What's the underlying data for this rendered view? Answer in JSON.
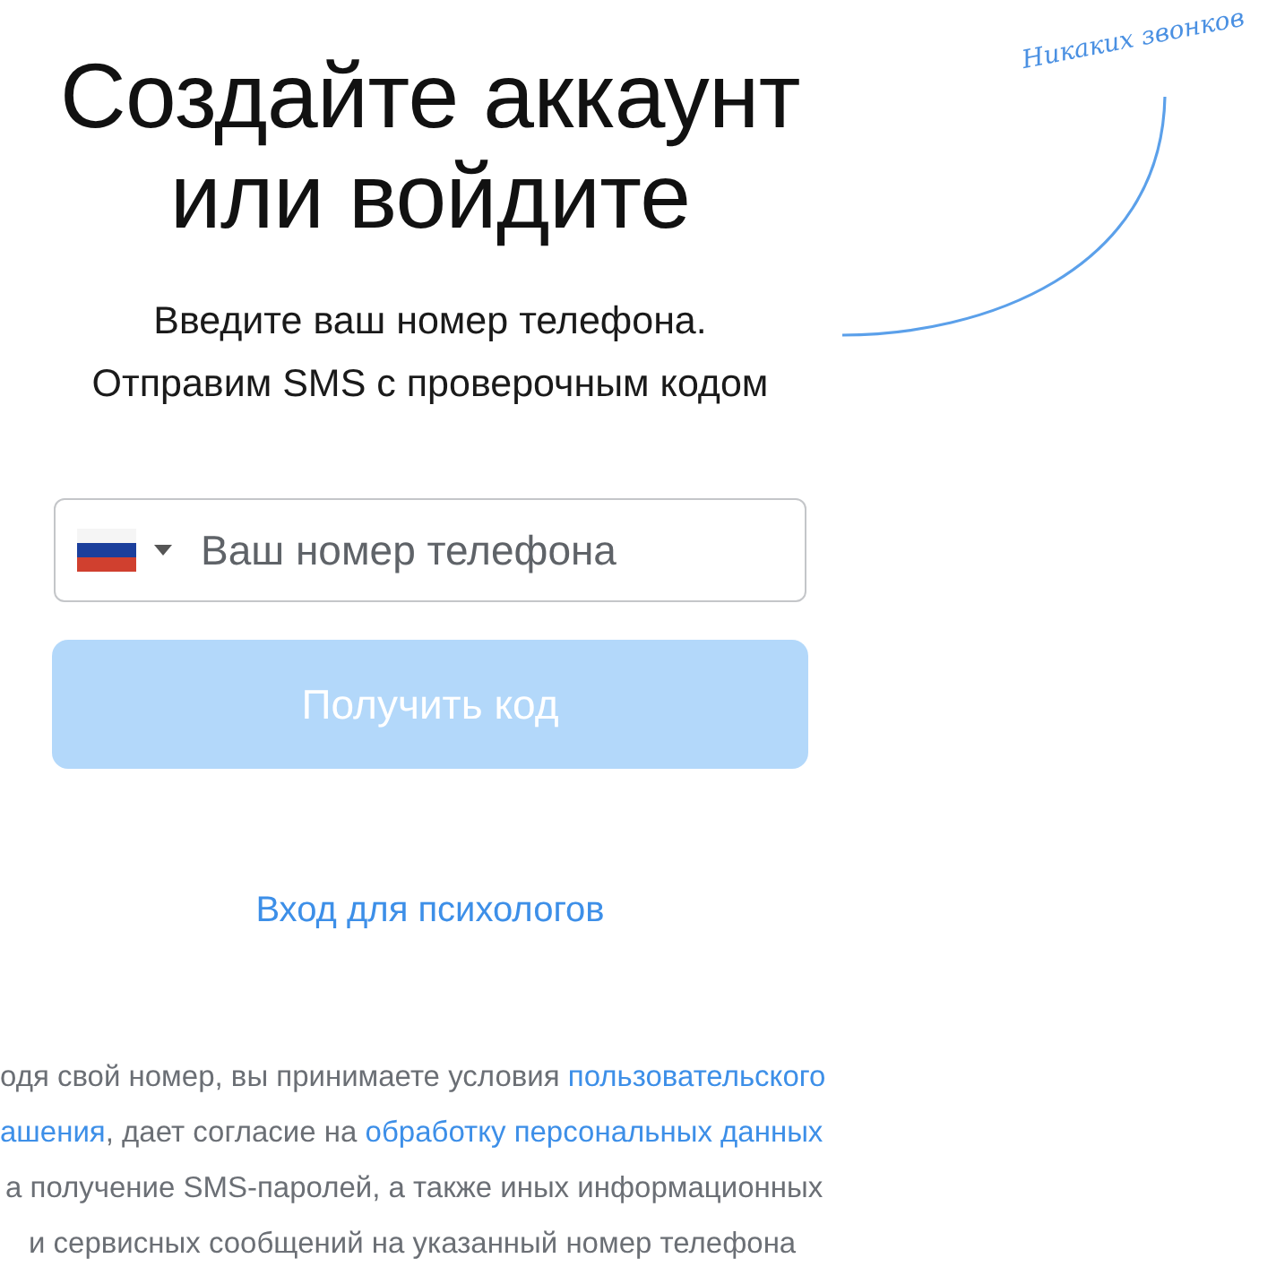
{
  "heading": "Создайте аккаунт или войдите",
  "subtitle": [
    "Введите ваш номер телефона.",
    "Отправим SMS с проверочным кодом"
  ],
  "note": "Никаких звонков",
  "phone_field": {
    "placeholder": "Ваш номер телефона"
  },
  "submit_button": {
    "label": "Получить код",
    "disabled": true
  },
  "psychologist_link": "Вход для психологов",
  "legal_lines": [
    {
      "parts": [
        {
          "text": "одя свой номер, вы принимаете условия ",
          "link": false
        },
        {
          "text": "пользовательского",
          "link": true
        }
      ]
    },
    {
      "parts": [
        {
          "text": "ашения",
          "link": true
        },
        {
          "text": ", дает согласие на ",
          "link": false
        },
        {
          "text": "обработку персональных данных",
          "link": true
        }
      ]
    },
    {
      "parts": [
        {
          "text": "а получение SMS-паролей, а также иных информационных",
          "link": false
        }
      ]
    },
    {
      "parts": [
        {
          "text": "и сервисных сообщений на указанный номер телефона",
          "link": false
        }
      ]
    }
  ]
}
